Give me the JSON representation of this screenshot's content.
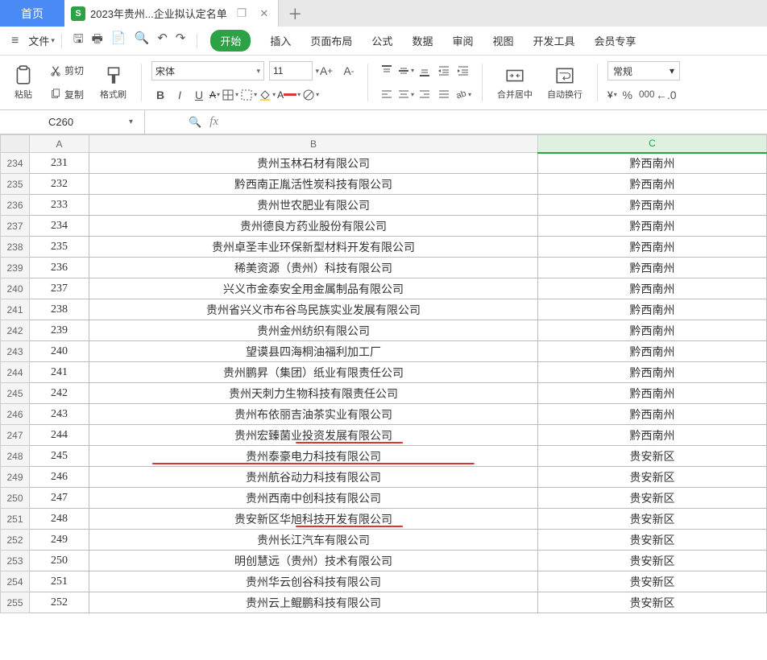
{
  "tabs": {
    "home": "首页",
    "file_name": "2023年贵州...企业拟认定名单",
    "dup_icon": "❐",
    "close_icon": "✕",
    "add_icon": "＋"
  },
  "menu": {
    "file": "文件",
    "quick": [
      "🖫",
      "🖶",
      "📄",
      "🔍",
      "↶",
      "↷"
    ],
    "ribbon_tabs": [
      "开始",
      "插入",
      "页面布局",
      "公式",
      "数据",
      "审阅",
      "视图",
      "开发工具",
      "会员专享"
    ]
  },
  "ribbon": {
    "paste": "粘贴",
    "cut": "剪切",
    "copy": "复制",
    "format_painter": "格式刷",
    "font_name": "宋体",
    "font_size": "11",
    "merge_center": "合并居中",
    "wrap_text": "自动换行",
    "number_format": "常规"
  },
  "cell_ref": {
    "name": "C260"
  },
  "columns": [
    "A",
    "B",
    "C"
  ],
  "col_widths": {
    "A": 74,
    "B": 558,
    "C": 280
  },
  "rows": [
    {
      "r": 234,
      "a": "231",
      "b": "贵州玉林石材有限公司",
      "c": "黔西南州"
    },
    {
      "r": 235,
      "a": "232",
      "b": "黔西南正胤活性炭科技有限公司",
      "c": "黔西南州"
    },
    {
      "r": 236,
      "a": "233",
      "b": "贵州世农肥业有限公司",
      "c": "黔西南州"
    },
    {
      "r": 237,
      "a": "234",
      "b": "贵州德良方药业股份有限公司",
      "c": "黔西南州"
    },
    {
      "r": 238,
      "a": "235",
      "b": "贵州卓圣丰业环保新型材料开发有限公司",
      "c": "黔西南州"
    },
    {
      "r": 239,
      "a": "236",
      "b": "稀美资源（贵州）科技有限公司",
      "c": "黔西南州"
    },
    {
      "r": 240,
      "a": "237",
      "b": "兴义市金泰安全用金属制品有限公司",
      "c": "黔西南州"
    },
    {
      "r": 241,
      "a": "238",
      "b": "贵州省兴义市布谷鸟民族实业发展有限公司",
      "c": "黔西南州"
    },
    {
      "r": 242,
      "a": "239",
      "b": "贵州金州纺织有限公司",
      "c": "黔西南州"
    },
    {
      "r": 243,
      "a": "240",
      "b": "望谟县四海桐油福利加工厂",
      "c": "黔西南州"
    },
    {
      "r": 244,
      "a": "241",
      "b": "贵州鹏昇（集团）纸业有限责任公司",
      "c": "黔西南州"
    },
    {
      "r": 245,
      "a": "242",
      "b": "贵州天刺力生物科技有限责任公司",
      "c": "黔西南州"
    },
    {
      "r": 246,
      "a": "243",
      "b": "贵州布依丽吉油茶实业有限公司",
      "c": "黔西南州"
    },
    {
      "r": 247,
      "a": "244",
      "b": "贵州宏臻菌业投资发展有限公司",
      "c": "黔西南州",
      "mark": "partial"
    },
    {
      "r": 248,
      "a": "245",
      "b": "贵州泰豪电力科技有限公司",
      "c": "贵安新区",
      "mark": "full"
    },
    {
      "r": 249,
      "a": "246",
      "b": "贵州航谷动力科技有限公司",
      "c": "贵安新区"
    },
    {
      "r": 250,
      "a": "247",
      "b": "贵州西南中创科技有限公司",
      "c": "贵安新区"
    },
    {
      "r": 251,
      "a": "248",
      "b": "贵安新区华旭科技开发有限公司",
      "c": "贵安新区",
      "mark": "partial"
    },
    {
      "r": 252,
      "a": "249",
      "b": "贵州长江汽车有限公司",
      "c": "贵安新区"
    },
    {
      "r": 253,
      "a": "250",
      "b": "明创慧远（贵州）技术有限公司",
      "c": "贵安新区"
    },
    {
      "r": 254,
      "a": "251",
      "b": "贵州华云创谷科技有限公司",
      "c": "贵安新区"
    },
    {
      "r": 255,
      "a": "252",
      "b": "贵州云上鲲鹏科技有限公司",
      "c": "贵安新区"
    }
  ]
}
